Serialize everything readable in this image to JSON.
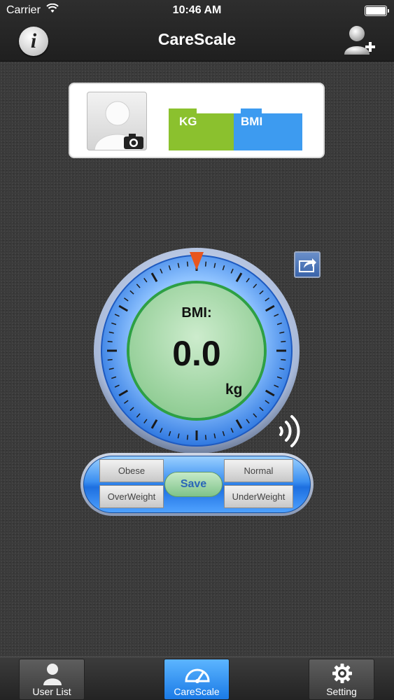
{
  "status_bar": {
    "carrier": "Carrier",
    "time": "10:46 AM"
  },
  "nav": {
    "title": "CareScale",
    "info_icon": "info-icon",
    "add_user_icon": "add-user-icon",
    "info_glyph": "i"
  },
  "profile": {
    "avatar_icon": "avatar-camera-icon",
    "tab_kg": "KG",
    "tab_bmi": "BMI"
  },
  "gauge": {
    "label": "BMI:",
    "value": "0.0",
    "unit": "kg",
    "share_icon": "share-icon",
    "signal_icon": "signal-icon"
  },
  "controls": {
    "obese": "Obese",
    "overweight": "OverWeight",
    "normal": "Normal",
    "underweight": "UnderWeight",
    "save": "Save"
  },
  "tabbar": {
    "items": [
      {
        "label": "User List",
        "icon": "user-icon"
      },
      {
        "label": "CareScale",
        "icon": "scale-icon"
      },
      {
        "label": "Setting",
        "icon": "gear-icon"
      }
    ],
    "active": "CareScale"
  },
  "colors": {
    "kg": "#8bc12e",
    "bmi": "#3d9bf0",
    "accent": "#1a7ae6",
    "pointer": "#e8561e"
  }
}
